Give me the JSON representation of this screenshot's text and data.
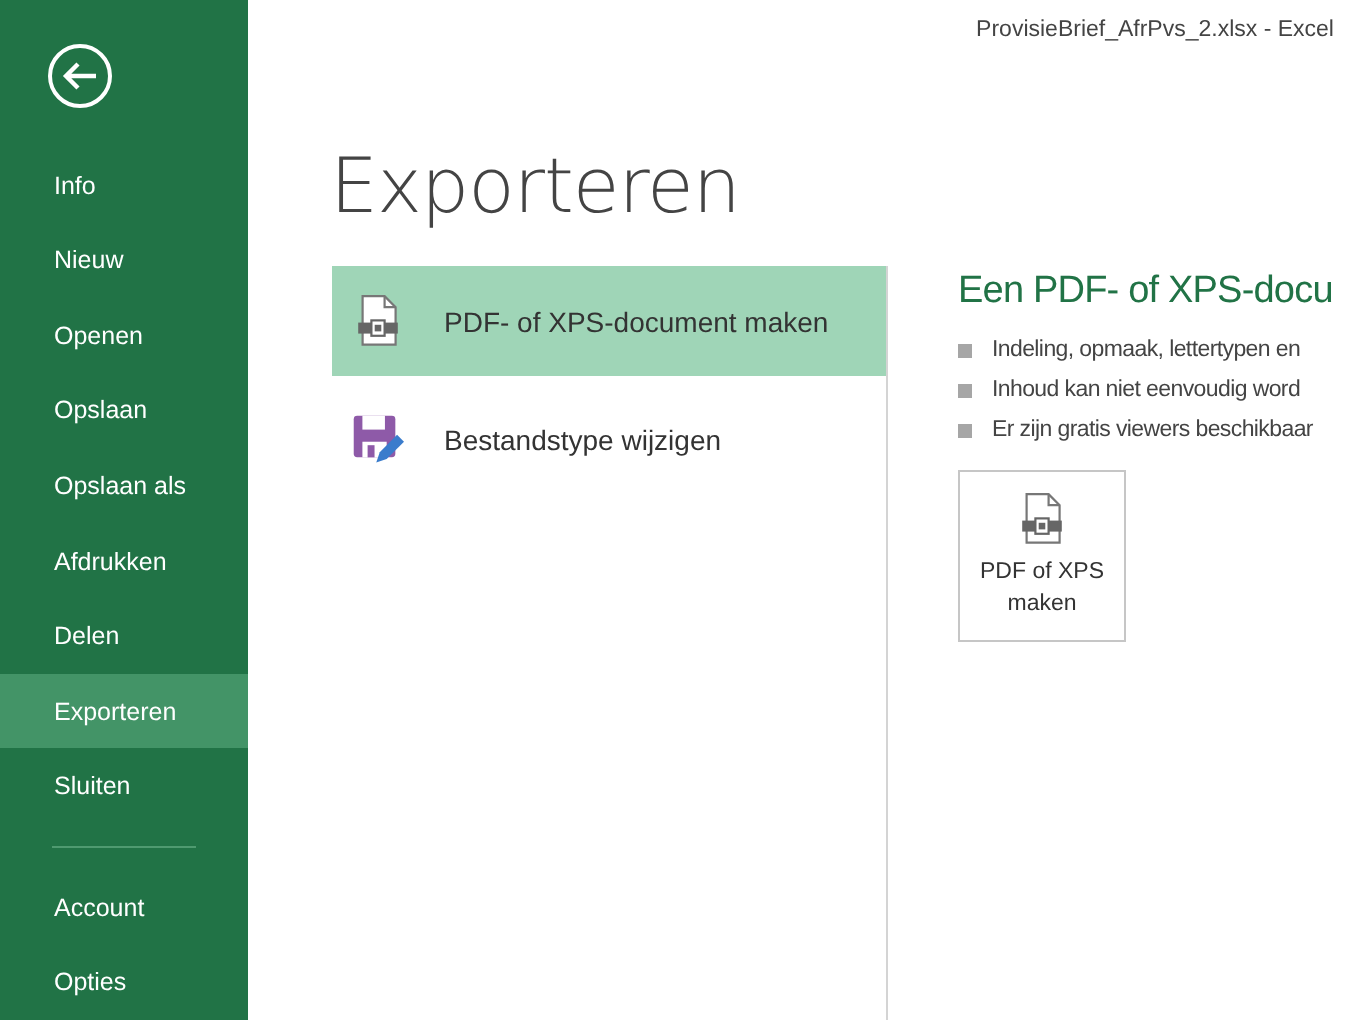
{
  "window": {
    "title": "ProvisieBrief_AfrPvs_2.xlsx - Excel"
  },
  "sidebar": {
    "items": [
      {
        "label": "Info",
        "selected": false
      },
      {
        "label": "Nieuw",
        "selected": false
      },
      {
        "label": "Openen",
        "selected": false
      },
      {
        "label": "Opslaan",
        "selected": false
      },
      {
        "label": "Opslaan als",
        "selected": false
      },
      {
        "label": "Afdrukken",
        "selected": false
      },
      {
        "label": "Delen",
        "selected": false
      },
      {
        "label": "Exporteren",
        "selected": true
      },
      {
        "label": "Sluiten",
        "selected": false
      }
    ],
    "footer_items": [
      {
        "label": "Account",
        "selected": false
      },
      {
        "label": "Opties",
        "selected": false
      }
    ]
  },
  "page_title": "Exporteren",
  "options": [
    {
      "kind": "pdf",
      "label": "PDF- of XPS-document maken",
      "selected": true
    },
    {
      "kind": "filetype",
      "label": "Bestandstype wijzigen",
      "selected": false
    }
  ],
  "detail": {
    "heading": "Een PDF- of XPS-docu",
    "bullets": [
      "Indeling, opmaak, lettertypen en",
      "Inhoud kan niet eenvoudig word",
      "Er zijn gratis viewers beschikbaar"
    ],
    "button": "PDF of XPS maken"
  }
}
